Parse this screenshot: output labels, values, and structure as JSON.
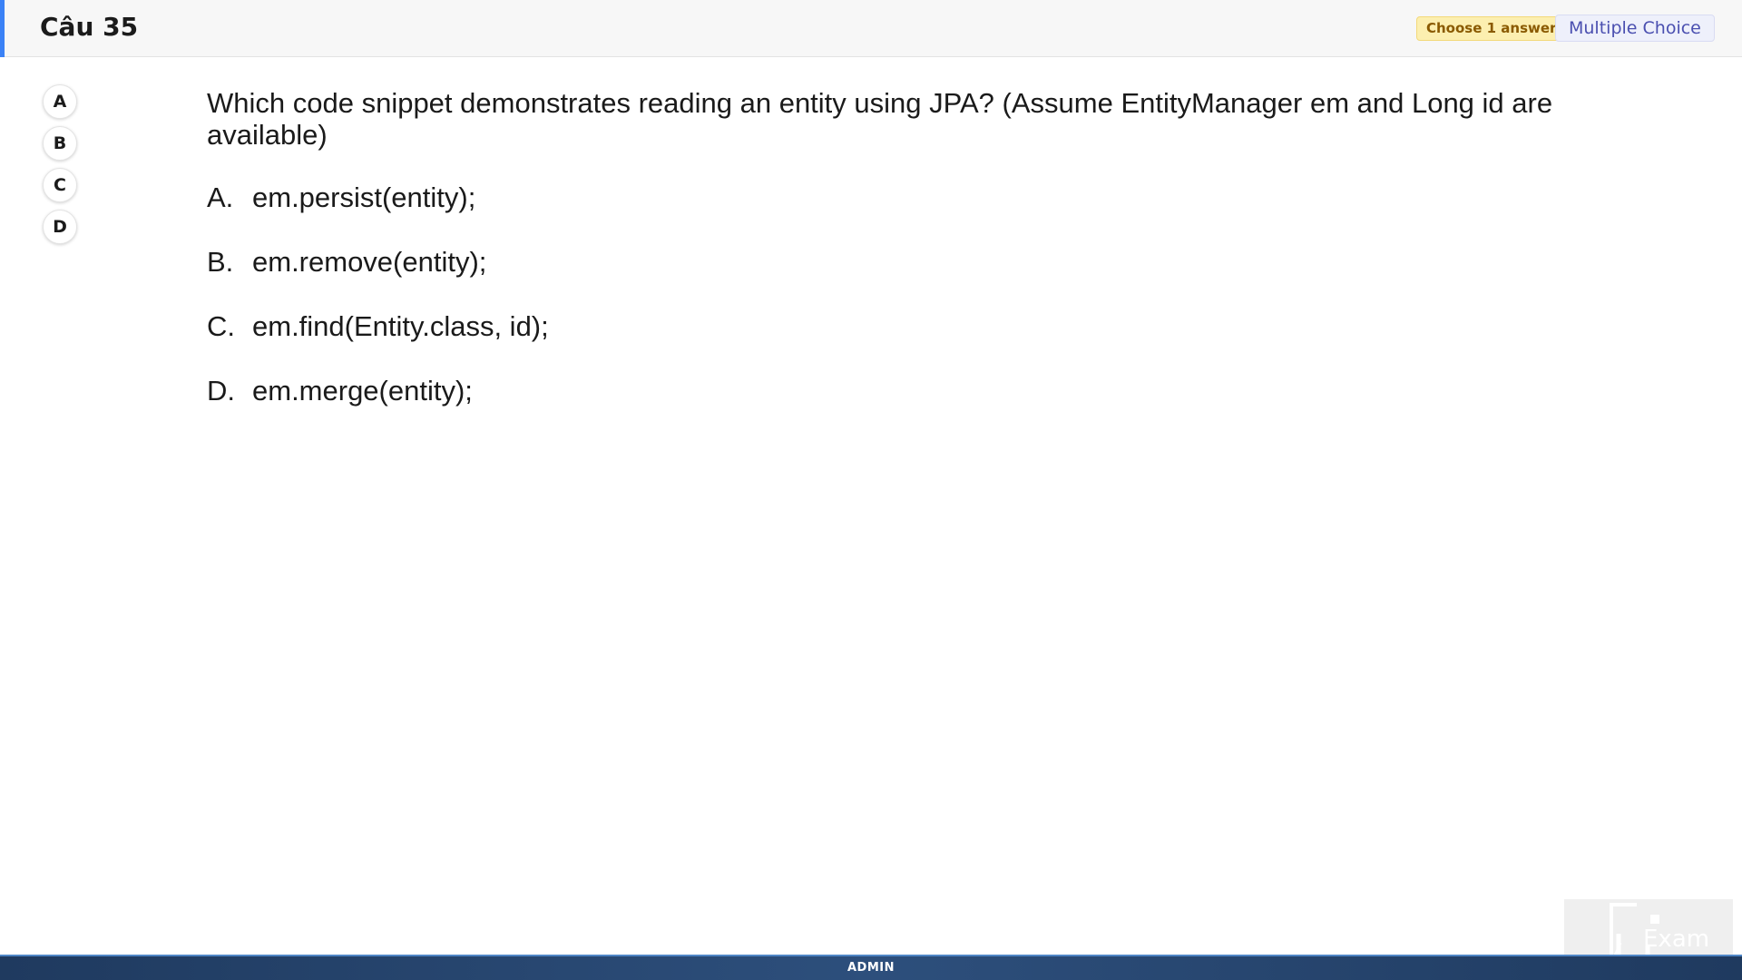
{
  "header": {
    "title": "Câu 35",
    "accent_color": "#3b82f6",
    "choose_badge": "Choose 1 answer",
    "type_badge": "Multiple Choice"
  },
  "option_buttons": [
    {
      "label": "A"
    },
    {
      "label": "B"
    },
    {
      "label": "C"
    },
    {
      "label": "D"
    }
  ],
  "question": {
    "text": "Which code snippet demonstrates reading an entity using JPA? (Assume EntityManager em and Long id are available)"
  },
  "answers": [
    {
      "letter": "A.",
      "text": "em.persist(entity);"
    },
    {
      "letter": "B.",
      "text": "em.remove(entity);"
    },
    {
      "letter": "C.",
      "text": "em.find(Entity.class, id);"
    },
    {
      "letter": "D.",
      "text": "em.merge(entity);"
    }
  ],
  "footer": {
    "user": "ADMIN"
  },
  "logo": {
    "name": "fu-exam-logo",
    "text": "Exam"
  }
}
